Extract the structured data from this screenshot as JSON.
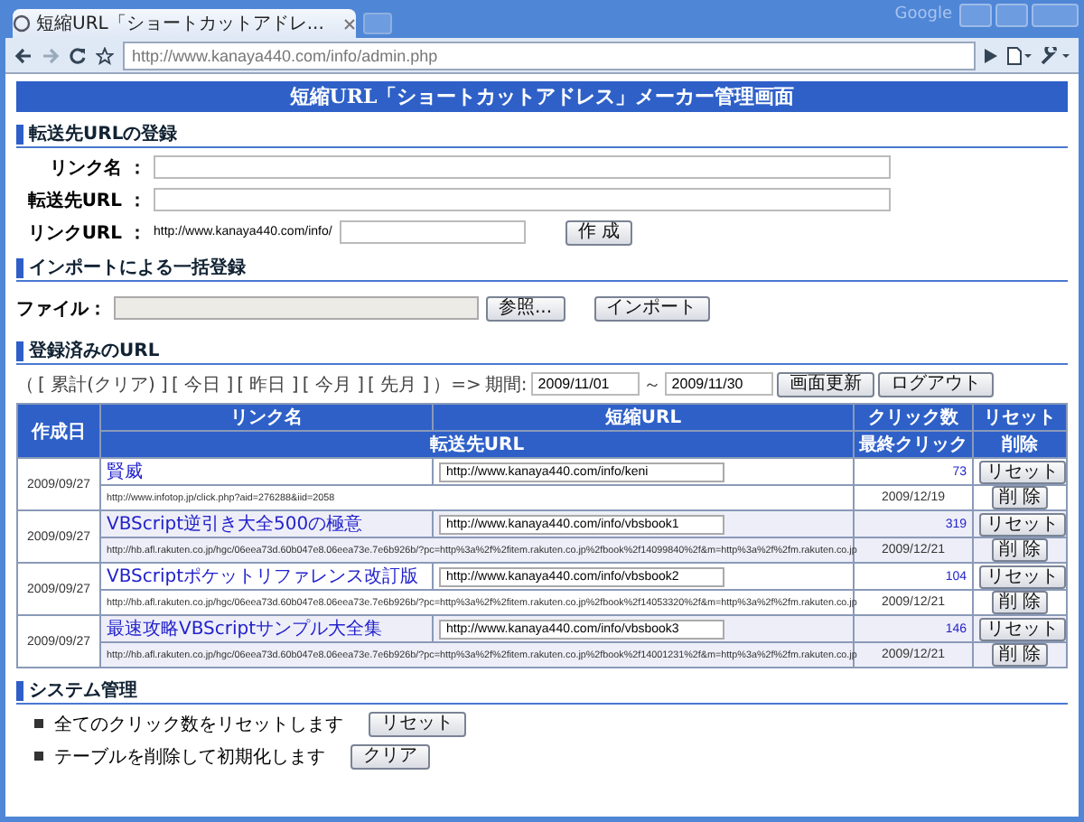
{
  "browser": {
    "tab_title": "短縮URL「ショートカットアドレ...",
    "brand": "Google",
    "address": "http://www.kanaya440.com/info/admin.php"
  },
  "page_title": "短縮URL「ショートカットアドレス」メーカー管理画面",
  "register": {
    "title": "転送先URLの登録",
    "fields": [
      {
        "label": "リンク名 ：",
        "kind": "wide"
      },
      {
        "label": "転送先URL ：",
        "kind": "wide"
      },
      {
        "label": "リンクURL ：",
        "prefix": "http://www.kanaya440.com/info/",
        "kind": "short"
      }
    ],
    "button": "作 成"
  },
  "import": {
    "title": "インポートによる一括登録",
    "file_label": "ファイル：",
    "browse_button": "参照...",
    "import_button": "インポート"
  },
  "registered": {
    "title": "登録済みのURL",
    "filter_open": "（",
    "filters": [
      "[ 累計(クリア) ]",
      "[ 今日 ]",
      "[ 昨日 ]",
      "[ 今月 ]",
      "[ 先月 ]"
    ],
    "filter_close": "）=>",
    "period_label": "期間:",
    "date_from": "2009/11/01",
    "separator": "～",
    "date_to": "2009/11/30",
    "refresh_button": "画面更新",
    "logout_button": "ログアウト"
  },
  "table": {
    "columns": {
      "created": "作成日",
      "name": "リンク名",
      "short_url": "短縮URL",
      "clicks": "クリック数",
      "reset": "リセット",
      "target_url": "転送先URL",
      "last_click": "最終クリック",
      "delete": "削除"
    },
    "rows": [
      {
        "date": "2009/09/27",
        "name": "賢威",
        "short_url": "http://www.kanaya440.com/info/keni",
        "clicks": "73",
        "reset_button": "リセット",
        "target_url": "http://www.infotop.jp/click.php?aid=276288&iid=2058",
        "last_click": "2009/12/19",
        "delete_button": "削 除"
      },
      {
        "date": "2009/09/27",
        "name": "VBScript逆引き大全500の極意",
        "short_url": "http://www.kanaya440.com/info/vbsbook1",
        "clicks": "319",
        "reset_button": "リセット",
        "target_url": "http://hb.afl.rakuten.co.jp/hgc/06eea73d.60b047e8.06eea73e.7e6b926b/?pc=http%3a%2f%2fitem.rakuten.co.jp%2fbook%2f14099840%2f&m=http%3a%2f%2fm.rakuten.co.jp",
        "last_click": "2009/12/21",
        "delete_button": "削 除"
      },
      {
        "date": "2009/09/27",
        "name": "VBScriptポケットリファレンス改訂版",
        "short_url": "http://www.kanaya440.com/info/vbsbook2",
        "clicks": "104",
        "reset_button": "リセット",
        "target_url": "http://hb.afl.rakuten.co.jp/hgc/06eea73d.60b047e8.06eea73e.7e6b926b/?pc=http%3a%2f%2fitem.rakuten.co.jp%2fbook%2f14053320%2f&m=http%3a%2f%2fm.rakuten.co.jp",
        "last_click": "2009/12/21",
        "delete_button": "削 除"
      },
      {
        "date": "2009/09/27",
        "name": "最速攻略VBScriptサンプル大全集",
        "short_url": "http://www.kanaya440.com/info/vbsbook3",
        "clicks": "146",
        "reset_button": "リセット",
        "target_url": "http://hb.afl.rakuten.co.jp/hgc/06eea73d.60b047e8.06eea73e.7e6b926b/?pc=http%3a%2f%2fitem.rakuten.co.jp%2fbook%2f14001231%2f&m=http%3a%2f%2fm.rakuten.co.jp",
        "last_click": "2009/12/21",
        "delete_button": "削 除"
      }
    ]
  },
  "system": {
    "title": "システム管理",
    "actions": [
      {
        "text": "全てのクリック数をリセットします",
        "button": "リセット"
      },
      {
        "text": "テーブルを削除して初期化します",
        "button": "クリア"
      }
    ]
  }
}
